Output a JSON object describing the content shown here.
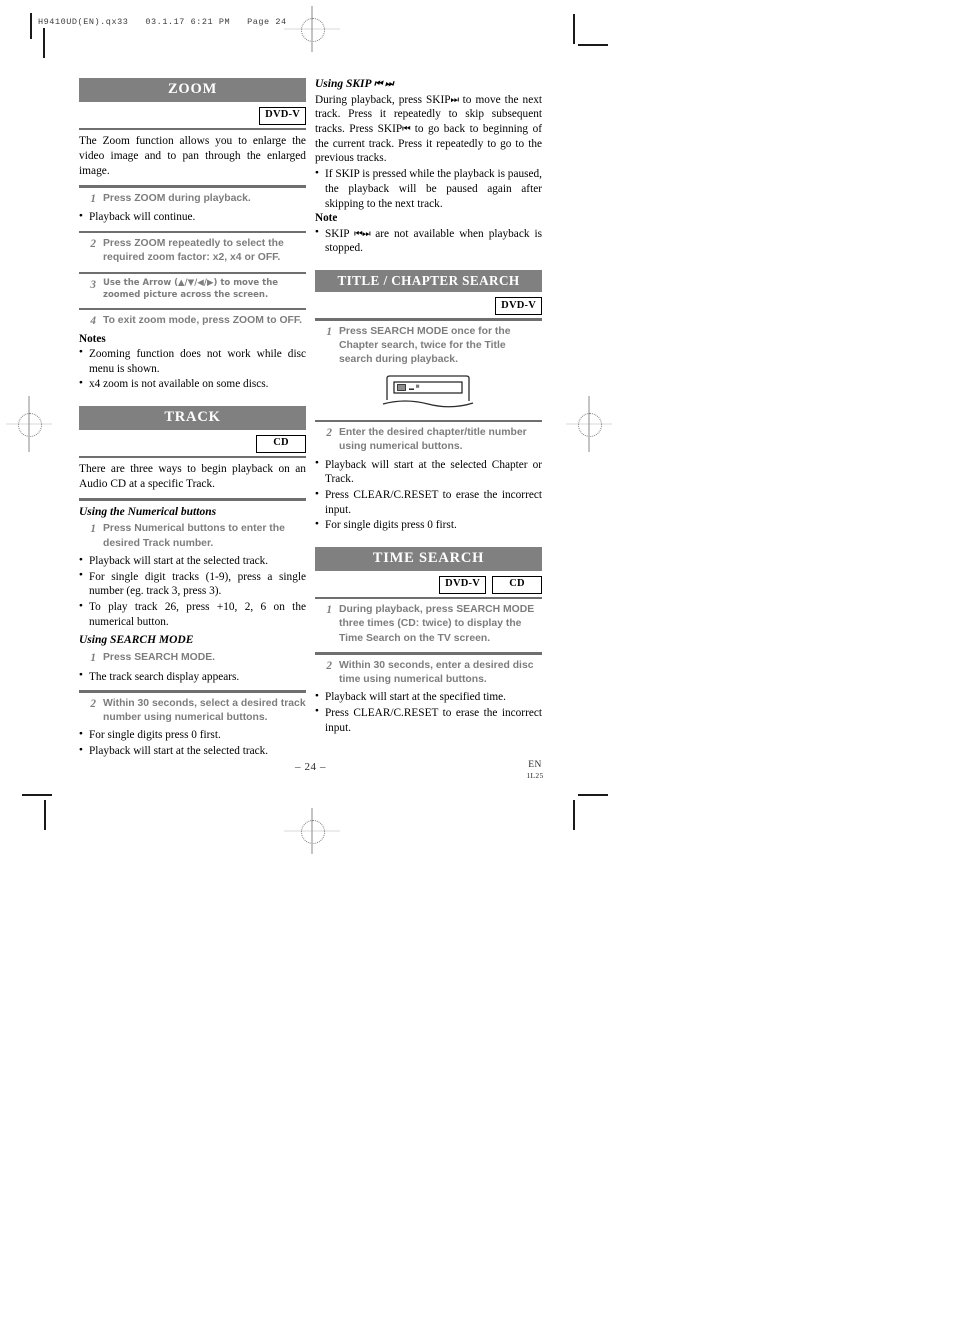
{
  "print_header": {
    "text": "H9410UD(EN).qx33   03.1.17 6:21 PM   Page 24"
  },
  "footer": {
    "page_number": "– 24 –",
    "language": "EN",
    "code": "1L25"
  },
  "left_column": {
    "zoom_section": {
      "title": "ZOOM",
      "badges": [
        "DVD-V"
      ],
      "intro": "The Zoom function allows you to enlarge the video image and to pan through the enlarged image.",
      "steps": [
        {
          "num": "1",
          "text": "Press ZOOM during playback."
        },
        {
          "num": "2",
          "text": "Press ZOOM repeatedly to select the required zoom factor: x2, x4 or OFF."
        },
        {
          "num": "3",
          "text": "Use the Arrow (▲/▼/◀/▶) to move the zoomed picture across the screen."
        },
        {
          "num": "4",
          "text": "To exit zoom mode, press ZOOM to OFF."
        }
      ],
      "step1_bullet": "Playback will continue.",
      "notes_label": "Notes",
      "notes": [
        "Zooming function does not work while disc menu is shown.",
        "x4 zoom is not available on some discs."
      ]
    },
    "track_section": {
      "title": "TRACK",
      "badges": [
        "CD"
      ],
      "intro": "There are three ways to begin playback on an Audio CD at a specific Track.",
      "numerical_subhead": "Using the Numerical buttons",
      "numerical_step": {
        "num": "1",
        "text": "Press Numerical buttons to enter the desired Track number."
      },
      "numerical_bullets": [
        "Playback will start at the selected track.",
        "For single digit tracks (1-9), press a single number (eg. track 3, press 3).",
        "To play track 26, press +10, 2, 6 on the numerical button."
      ],
      "searchmode_subhead": "Using SEARCH MODE",
      "searchmode_step1": {
        "num": "1",
        "text": "Press SEARCH MODE."
      },
      "searchmode_bullet1": "The track search display appears.",
      "searchmode_step2": {
        "num": "2",
        "text": "Within 30 seconds, select a desired track number using numerical buttons."
      },
      "searchmode_bullets2": [
        "For single digits press 0 first.",
        "Playback will start at the selected track."
      ]
    }
  },
  "right_column": {
    "skip_section": {
      "subhead": "Using SKIP",
      "subhead_symbols": "⏮ ⏭",
      "paragraph_1": "During playback, press SKIP",
      "paragraph_2": "to move the next track. Press it repeatedly to skip subsequent tracks. Press SKIP",
      "paragraph_3": "to go back to beginning of the current track. Press it repeatedly to go to the previous tracks.",
      "bullet": "If SKIP is pressed while the playback is paused, the playback will be paused again after skipping to the next track.",
      "note_label": "Note",
      "note_text_1": "SKIP",
      "note_text_2": "are not available when playback is stopped."
    },
    "title_chapter_section": {
      "title": "TITLE / CHAPTER SEARCH",
      "badges": [
        "DVD-V"
      ],
      "step1": {
        "num": "1",
        "text": "Press SEARCH MODE once for the Chapter search, twice for the Title search during playback."
      },
      "figure_name": "tv-screen-chapter-search-display",
      "step2": {
        "num": "2",
        "text": "Enter the desired chapter/title number using numerical buttons."
      },
      "bullets": [
        "Playback will start at the selected Chapter or Track.",
        "Press CLEAR/C.RESET to erase the incorrect input.",
        "For single digits press 0 first."
      ]
    },
    "time_search_section": {
      "title": "TIME SEARCH",
      "badges": [
        "DVD-V",
        "CD"
      ],
      "step1": {
        "num": "1",
        "text": "During playback, press SEARCH MODE three times (CD: twice) to display the Time Search on the TV screen."
      },
      "step2": {
        "num": "2",
        "text": "Within 30 seconds, enter a desired disc time using numerical buttons."
      },
      "bullets": [
        "Playback will start at the specified time.",
        "Press CLEAR/C.RESET to erase the incorrect input."
      ]
    }
  },
  "colors": {
    "band": "#808080",
    "rule": "#6f6f6f",
    "step_text": "#7d7d7d"
  }
}
